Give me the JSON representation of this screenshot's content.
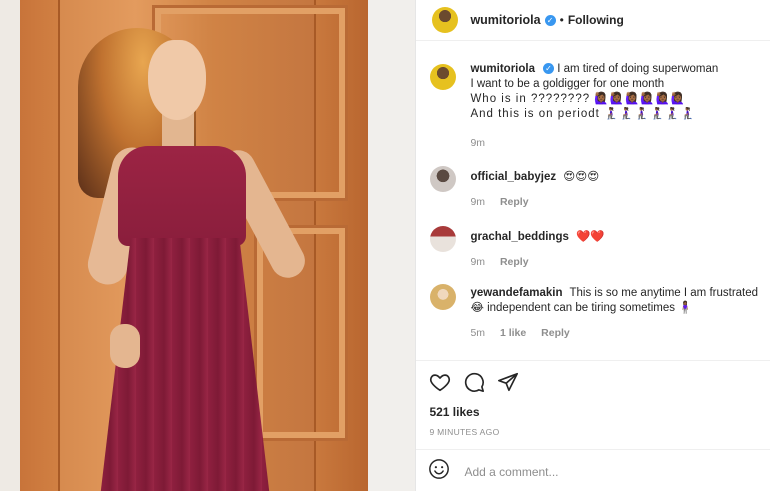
{
  "header": {
    "username": "wumitoriola",
    "separator": "•",
    "follow_status": "Following"
  },
  "caption": {
    "username": "wumitoriola",
    "line1": "I am tired of doing superwoman",
    "line2": "I want to be a goldigger for one month",
    "line3": "Who is in ???????? 🙋🏾‍♀️🙋🏾‍♀️🙋🏾‍♀️🙋🏾‍♀️🙋🏾‍♀️🙋🏾‍♀️",
    "line4": "And this is on periodt 🧎🏾‍♀️🧎🏾‍♀️🧎🏾‍♀️🧎🏾‍♀️🧎🏾‍♀️🧎🏾‍♀️",
    "time": "9m"
  },
  "comments": [
    {
      "username": "official_babyjez",
      "text": "😍😍😍",
      "time": "9m",
      "reply": "Reply"
    },
    {
      "username": "grachal_beddings",
      "text": "❤️❤️",
      "time": "9m",
      "reply": "Reply"
    },
    {
      "username": "yewandefamakin",
      "text": "This is so me anytime I am frustrated 😂 independent can be tiring sometimes 🧍🏾‍♀️",
      "time": "5m",
      "likes": "1 like",
      "reply": "Reply"
    }
  ],
  "post": {
    "likes": "521 likes",
    "time_ago": "9 MINUTES AGO"
  },
  "add_comment": {
    "placeholder": "Add a comment..."
  },
  "icons": {
    "like": "heart-icon",
    "comment": "comment-icon",
    "share": "share-icon",
    "emoji": "smiley-icon",
    "verified": "verified-badge-icon"
  },
  "colors": {
    "verified": "#3897f0",
    "meta_gray": "#8e8e8e"
  }
}
